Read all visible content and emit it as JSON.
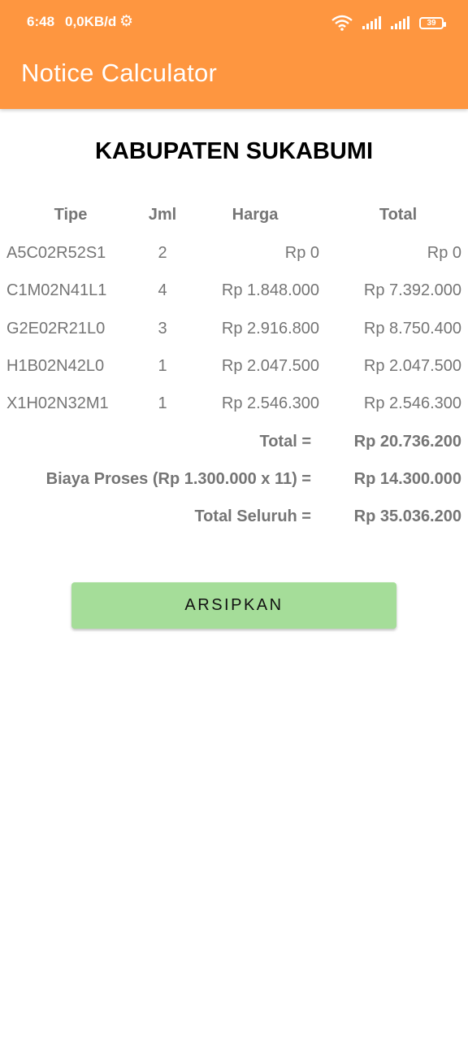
{
  "status_bar": {
    "time": "6:48",
    "speed": "0,0KB/d",
    "battery": "39"
  },
  "app_bar": {
    "title": "Notice Calculator"
  },
  "heading": "KABUPATEN SUKABUMI",
  "table": {
    "headers": [
      "Tipe",
      "Jml",
      "Harga",
      "Total"
    ],
    "rows": [
      {
        "tipe": "A5C02R52S1",
        "jml": "2",
        "harga": "Rp 0",
        "total": "Rp 0"
      },
      {
        "tipe": "C1M02N41L1",
        "jml": "4",
        "harga": "Rp 1.848.000",
        "total": "Rp 7.392.000"
      },
      {
        "tipe": "G2E02R21L0",
        "jml": "3",
        "harga": "Rp 2.916.800",
        "total": "Rp 8.750.400"
      },
      {
        "tipe": "H1B02N42L0",
        "jml": "1",
        "harga": "Rp 2.047.500",
        "total": "Rp 2.047.500"
      },
      {
        "tipe": "X1H02N32M1",
        "jml": "1",
        "harga": "Rp 2.546.300",
        "total": "Rp 2.546.300"
      }
    ]
  },
  "summary": [
    {
      "label": "Total =",
      "value": "Rp 20.736.200"
    },
    {
      "label": "Biaya Proses (Rp 1.300.000 x 11) =",
      "value": "Rp 14.300.000"
    },
    {
      "label": "Total Seluruh =",
      "value": "Rp 35.036.200"
    }
  ],
  "archive_button": "ARSIPKAN",
  "icons": {
    "settings": "gear-icon",
    "wifi": "wifi-icon",
    "signal": "cell-signal-icon",
    "battery": "battery-icon"
  },
  "colors": {
    "app_bar": "#fe9640",
    "button": "#a5dd99",
    "text_gray": "#757575"
  }
}
